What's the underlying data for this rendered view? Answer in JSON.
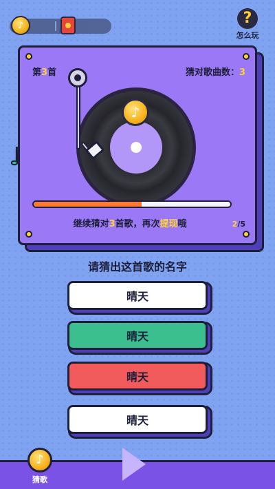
{
  "topbar": {
    "coin_icon": "music-coin-icon",
    "redpacket_icon": "red-packet-icon",
    "howto_label": "怎么玩",
    "howto_icon_glyph": "?"
  },
  "card": {
    "round_prefix": "第",
    "round_num": "3",
    "round_suffix": "首",
    "count_label": "猜对歌曲数：",
    "count_value": "3",
    "note_glyph": "♪",
    "progress_fraction": 0.55,
    "hint_pre": "继续猜对",
    "hint_num": "3",
    "hint_mid": "首歌，再次",
    "hint_highlight": "提现",
    "hint_post": "哦",
    "pager_current": "2",
    "pager_total": "/5"
  },
  "question": "请猜出这首歌的名字",
  "answers": [
    {
      "label": "晴天",
      "color": "#ffffff"
    },
    {
      "label": "晴天",
      "color": "#3cbf8f"
    },
    {
      "label": "晴天",
      "color": "#f25b5b"
    },
    {
      "label": "晴天",
      "color": "#ffffff"
    }
  ],
  "bottom_nav": {
    "guess_label": "猜歌",
    "guess_icon_glyph": "♪"
  },
  "colors": {
    "background": "#7fa3f0",
    "card": "#9b78f5",
    "accent_yellow": "#ffd23a",
    "progress": "#ff7a2f"
  }
}
